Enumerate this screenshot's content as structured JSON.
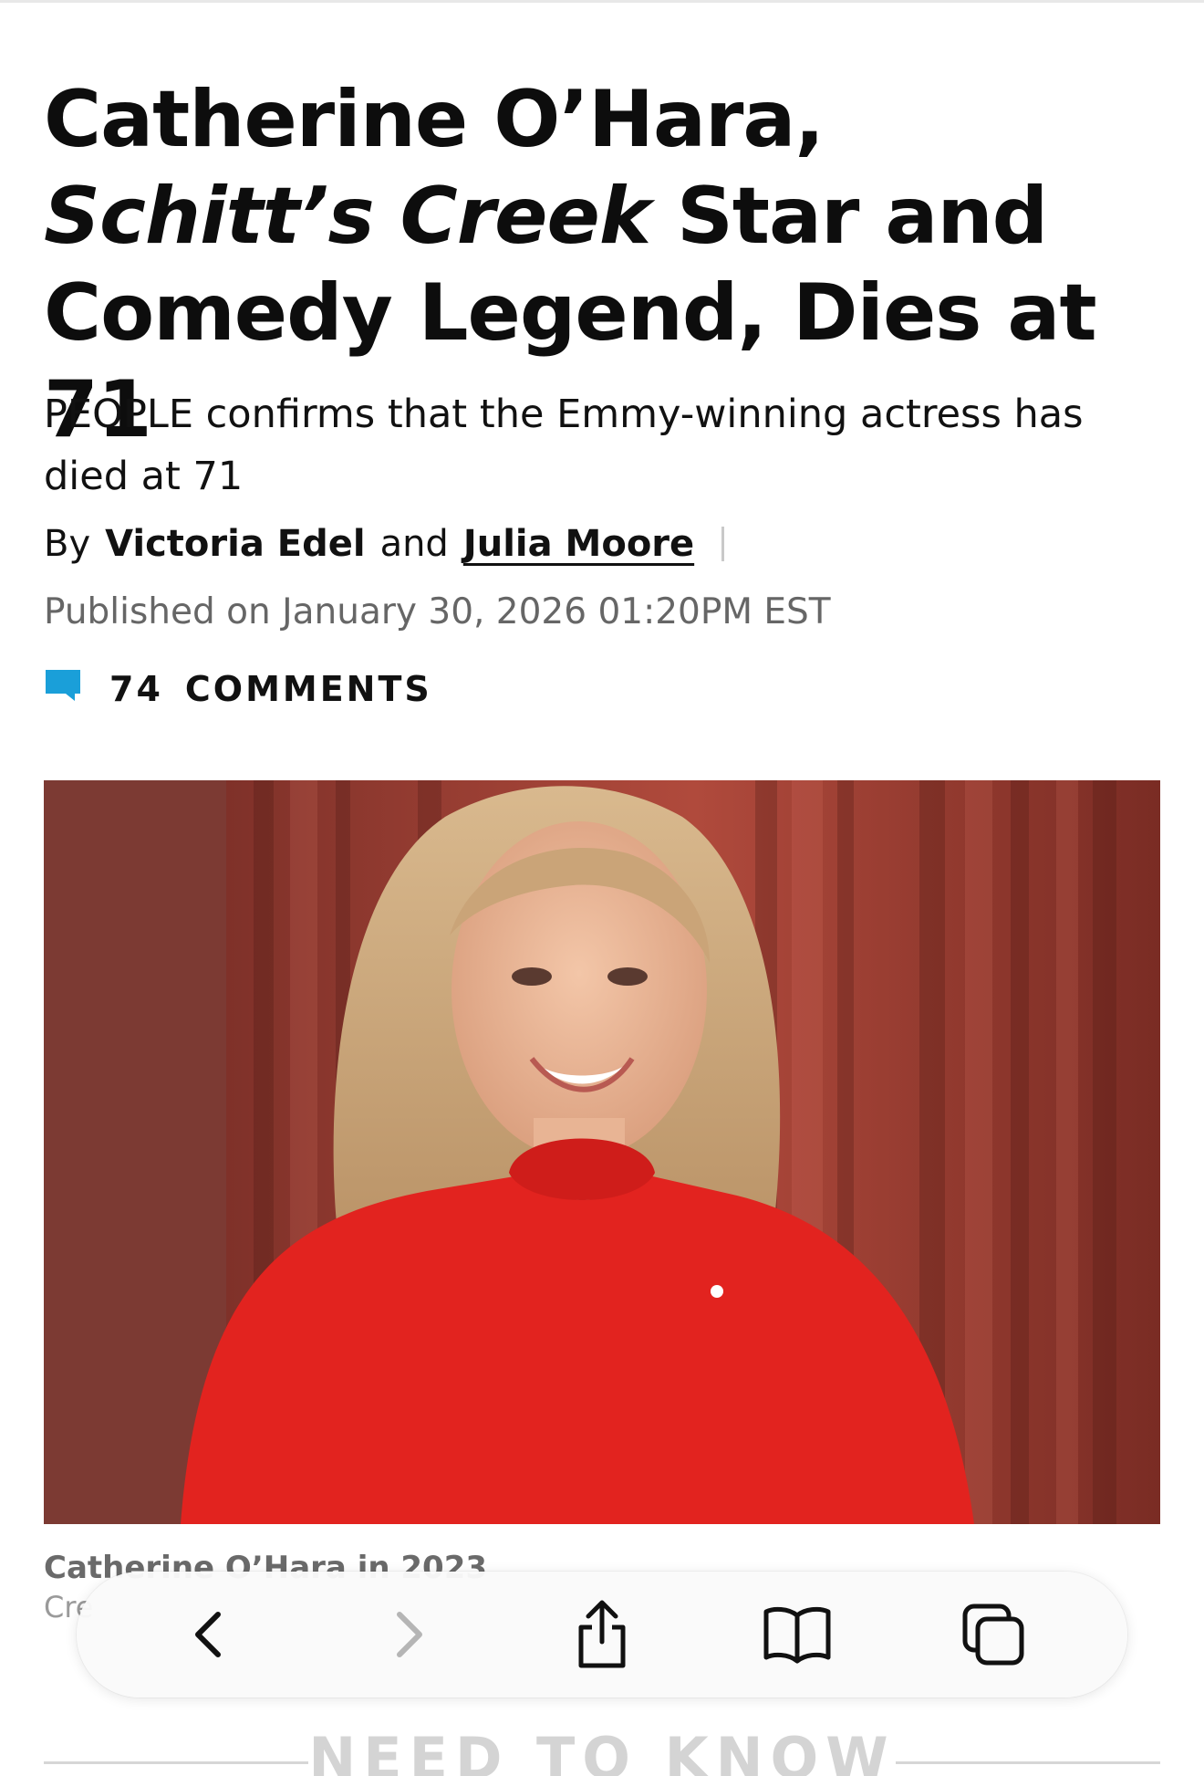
{
  "article": {
    "headline": {
      "part1": "Catherine O’Hara, ",
      "italic1": "Schitt’s",
      "space": " ",
      "italic2": "Creek",
      "part2": " Star and Comedy Legend, Dies at 71"
    },
    "dek": "PEOPLE confirms that the Emmy-winning actress has died at 71",
    "byline": {
      "prefix": "By",
      "author1": "Victoria Edel",
      "conjunction": "and",
      "author2": "Julia Moore"
    },
    "published": "Published on January 30, 2026 01:20PM EST",
    "comments": {
      "count": "74",
      "label": "COMMENTS"
    },
    "image": {
      "caption": "Catherine O’Hara in 2023",
      "credit": "Cre"
    },
    "section_heading": "NEED TO KNOW"
  },
  "colors": {
    "accent_blue": "#1a9fd9",
    "comment_icon": "#1a9fd9",
    "muted_text": "#666666"
  },
  "toolbar": {
    "icons": [
      "back-icon",
      "forward-icon",
      "share-icon",
      "bookmarks-icon",
      "tabs-icon"
    ]
  }
}
